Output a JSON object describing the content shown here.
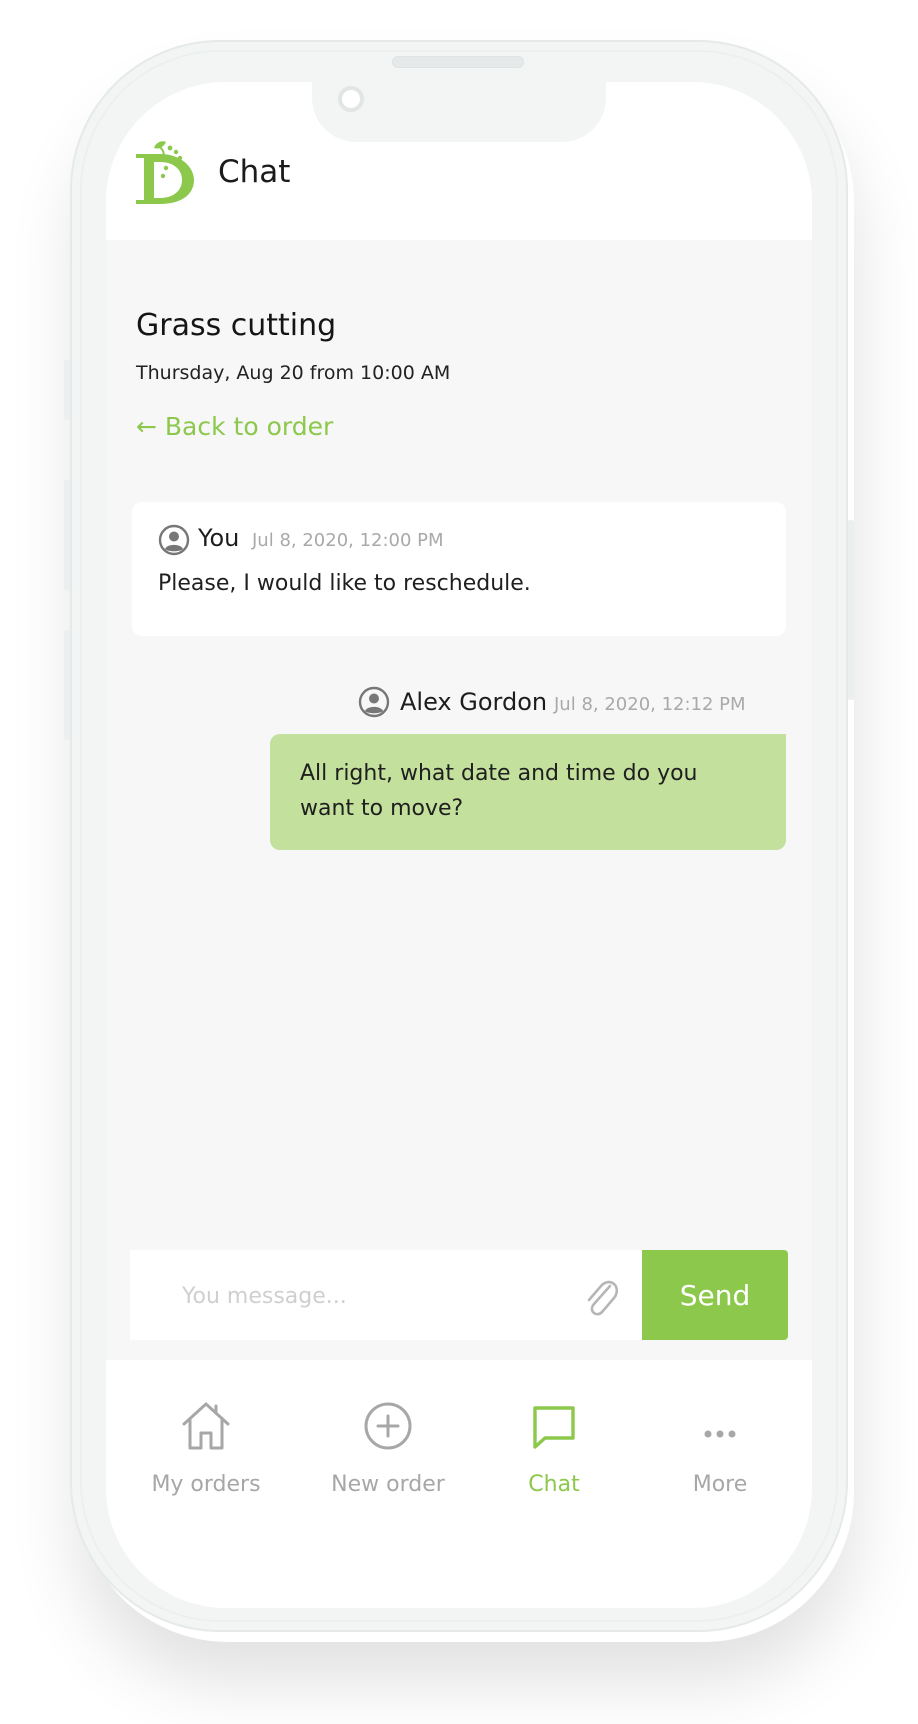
{
  "header": {
    "title": "Chat"
  },
  "order": {
    "title": "Grass cutting",
    "date": "Thursday, Aug 20 from 10:00 AM",
    "back_label": "← Back to order"
  },
  "messages": [
    {
      "sender": "You",
      "time": "Jul 8, 2020, 12:00 PM",
      "text": "Please, I would like to reschedule."
    },
    {
      "sender": "Alex Gordon",
      "time": "Jul 8, 2020, 12:12 PM",
      "text": "All right, what date and time do you want to move?"
    }
  ],
  "composer": {
    "placeholder": "You message...",
    "send_label": "Send"
  },
  "tabs": [
    {
      "label": "My orders",
      "icon": "home-icon"
    },
    {
      "label": "New order",
      "icon": "plus-circle-icon"
    },
    {
      "label": "Chat",
      "icon": "chat-bubble-icon",
      "active": true
    },
    {
      "label": "More",
      "icon": "more-dots-icon"
    }
  ],
  "colors": {
    "accent": "#8cc84b",
    "bubble": "#c3e09d",
    "muted": "#a7a7a7",
    "background": "#f7f7f7"
  }
}
